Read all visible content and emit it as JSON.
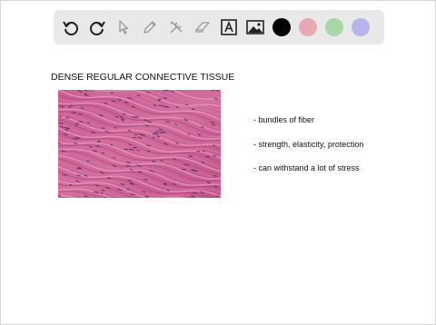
{
  "toolbar": {
    "tools": [
      "undo-icon",
      "redo-icon",
      "pointer-icon",
      "pen-icon",
      "tools-icon",
      "eraser-icon",
      "text-icon",
      "image-icon"
    ],
    "colors": [
      "#000000",
      "#e8a8b4",
      "#a8d8a8",
      "#b8b4ec"
    ]
  },
  "slide": {
    "title": "DENSE REGULAR CONNECTIVE TISSUE",
    "bullets": [
      "- bundles of fiber",
      "- strength, elasticity, protection",
      "- can withstand a lot of stress"
    ]
  }
}
